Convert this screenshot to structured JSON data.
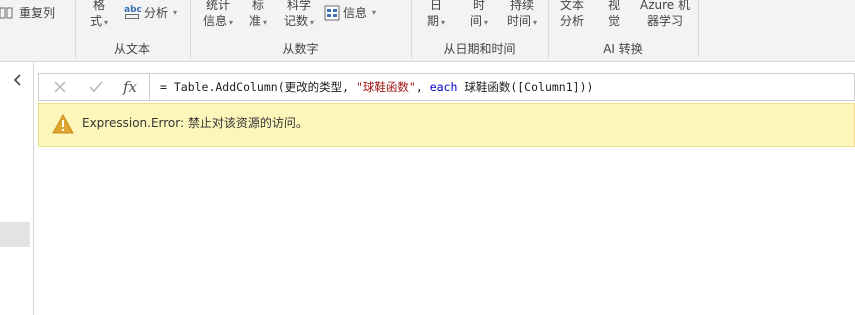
{
  "ribbon": {
    "groups": {
      "text": {
        "label": "从文本",
        "format_line1": "格",
        "format_line2": "式",
        "repeat_label": "重复列",
        "parse_label": "分析",
        "parse_icon_text": "abc"
      },
      "number": {
        "label": "从数字",
        "statistics_line1": "统计",
        "statistics_line2": "信息",
        "standard_line1": "标",
        "standard_line2": "准",
        "scientific_line1": "科学",
        "scientific_line2": "记数",
        "information_label": "信息"
      },
      "datetime": {
        "label": "从日期和时间",
        "date_line1": "日",
        "date_line2": "期",
        "time_line1": "时",
        "time_line2": "间",
        "duration_line1": "持续",
        "duration_line2": "时间"
      },
      "ai": {
        "label": "AI 转换",
        "text_analytics_line1": "文本",
        "text_analytics_line2": "分析",
        "vision_line1": "视",
        "vision_line2": "觉",
        "azure_ml_line1": "Azure 机",
        "azure_ml_line2": "器学习"
      }
    }
  },
  "left_pane": {
    "collapse_icon": "chevron-left-icon"
  },
  "formula_bar": {
    "cancel_icon": "close-icon",
    "commit_icon": "check-icon",
    "fx_label": "fx",
    "formula_prefix": "= Table.AddColumn(更改的类型, ",
    "formula_string": "\"球鞋函数\"",
    "formula_sep": ", ",
    "formula_keyword": "each",
    "formula_suffix": " 球鞋函数([Column1]))"
  },
  "error": {
    "icon": "warning-icon",
    "message": "Expression.Error: 禁止对该资源的访问。"
  },
  "colors": {
    "ribbon_bg": "#f3f3f3",
    "error_bg": "#fdf6ba",
    "warning_icon": "#e0a52e",
    "string_literal": "#a31515",
    "keyword": "#0000cc"
  }
}
